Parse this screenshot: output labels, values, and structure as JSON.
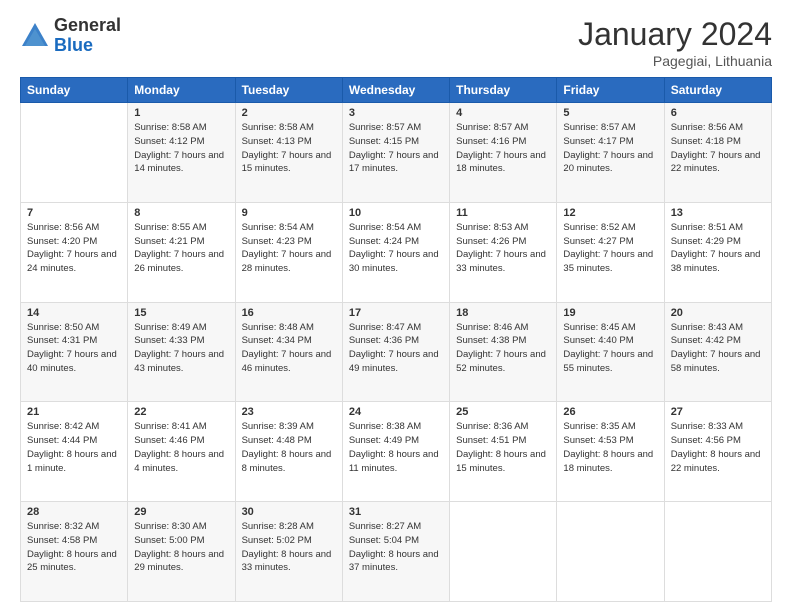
{
  "logo": {
    "general": "General",
    "blue": "Blue"
  },
  "header": {
    "month": "January 2024",
    "location": "Pagegiai, Lithuania"
  },
  "days": [
    "Sunday",
    "Monday",
    "Tuesday",
    "Wednesday",
    "Thursday",
    "Friday",
    "Saturday"
  ],
  "weeks": [
    [
      {
        "day": "",
        "sunrise": "",
        "sunset": "",
        "daylight": ""
      },
      {
        "day": "1",
        "sunrise": "Sunrise: 8:58 AM",
        "sunset": "Sunset: 4:12 PM",
        "daylight": "Daylight: 7 hours and 14 minutes."
      },
      {
        "day": "2",
        "sunrise": "Sunrise: 8:58 AM",
        "sunset": "Sunset: 4:13 PM",
        "daylight": "Daylight: 7 hours and 15 minutes."
      },
      {
        "day": "3",
        "sunrise": "Sunrise: 8:57 AM",
        "sunset": "Sunset: 4:15 PM",
        "daylight": "Daylight: 7 hours and 17 minutes."
      },
      {
        "day": "4",
        "sunrise": "Sunrise: 8:57 AM",
        "sunset": "Sunset: 4:16 PM",
        "daylight": "Daylight: 7 hours and 18 minutes."
      },
      {
        "day": "5",
        "sunrise": "Sunrise: 8:57 AM",
        "sunset": "Sunset: 4:17 PM",
        "daylight": "Daylight: 7 hours and 20 minutes."
      },
      {
        "day": "6",
        "sunrise": "Sunrise: 8:56 AM",
        "sunset": "Sunset: 4:18 PM",
        "daylight": "Daylight: 7 hours and 22 minutes."
      }
    ],
    [
      {
        "day": "7",
        "sunrise": "Sunrise: 8:56 AM",
        "sunset": "Sunset: 4:20 PM",
        "daylight": "Daylight: 7 hours and 24 minutes."
      },
      {
        "day": "8",
        "sunrise": "Sunrise: 8:55 AM",
        "sunset": "Sunset: 4:21 PM",
        "daylight": "Daylight: 7 hours and 26 minutes."
      },
      {
        "day": "9",
        "sunrise": "Sunrise: 8:54 AM",
        "sunset": "Sunset: 4:23 PM",
        "daylight": "Daylight: 7 hours and 28 minutes."
      },
      {
        "day": "10",
        "sunrise": "Sunrise: 8:54 AM",
        "sunset": "Sunset: 4:24 PM",
        "daylight": "Daylight: 7 hours and 30 minutes."
      },
      {
        "day": "11",
        "sunrise": "Sunrise: 8:53 AM",
        "sunset": "Sunset: 4:26 PM",
        "daylight": "Daylight: 7 hours and 33 minutes."
      },
      {
        "day": "12",
        "sunrise": "Sunrise: 8:52 AM",
        "sunset": "Sunset: 4:27 PM",
        "daylight": "Daylight: 7 hours and 35 minutes."
      },
      {
        "day": "13",
        "sunrise": "Sunrise: 8:51 AM",
        "sunset": "Sunset: 4:29 PM",
        "daylight": "Daylight: 7 hours and 38 minutes."
      }
    ],
    [
      {
        "day": "14",
        "sunrise": "Sunrise: 8:50 AM",
        "sunset": "Sunset: 4:31 PM",
        "daylight": "Daylight: 7 hours and 40 minutes."
      },
      {
        "day": "15",
        "sunrise": "Sunrise: 8:49 AM",
        "sunset": "Sunset: 4:33 PM",
        "daylight": "Daylight: 7 hours and 43 minutes."
      },
      {
        "day": "16",
        "sunrise": "Sunrise: 8:48 AM",
        "sunset": "Sunset: 4:34 PM",
        "daylight": "Daylight: 7 hours and 46 minutes."
      },
      {
        "day": "17",
        "sunrise": "Sunrise: 8:47 AM",
        "sunset": "Sunset: 4:36 PM",
        "daylight": "Daylight: 7 hours and 49 minutes."
      },
      {
        "day": "18",
        "sunrise": "Sunrise: 8:46 AM",
        "sunset": "Sunset: 4:38 PM",
        "daylight": "Daylight: 7 hours and 52 minutes."
      },
      {
        "day": "19",
        "sunrise": "Sunrise: 8:45 AM",
        "sunset": "Sunset: 4:40 PM",
        "daylight": "Daylight: 7 hours and 55 minutes."
      },
      {
        "day": "20",
        "sunrise": "Sunrise: 8:43 AM",
        "sunset": "Sunset: 4:42 PM",
        "daylight": "Daylight: 7 hours and 58 minutes."
      }
    ],
    [
      {
        "day": "21",
        "sunrise": "Sunrise: 8:42 AM",
        "sunset": "Sunset: 4:44 PM",
        "daylight": "Daylight: 8 hours and 1 minute."
      },
      {
        "day": "22",
        "sunrise": "Sunrise: 8:41 AM",
        "sunset": "Sunset: 4:46 PM",
        "daylight": "Daylight: 8 hours and 4 minutes."
      },
      {
        "day": "23",
        "sunrise": "Sunrise: 8:39 AM",
        "sunset": "Sunset: 4:48 PM",
        "daylight": "Daylight: 8 hours and 8 minutes."
      },
      {
        "day": "24",
        "sunrise": "Sunrise: 8:38 AM",
        "sunset": "Sunset: 4:49 PM",
        "daylight": "Daylight: 8 hours and 11 minutes."
      },
      {
        "day": "25",
        "sunrise": "Sunrise: 8:36 AM",
        "sunset": "Sunset: 4:51 PM",
        "daylight": "Daylight: 8 hours and 15 minutes."
      },
      {
        "day": "26",
        "sunrise": "Sunrise: 8:35 AM",
        "sunset": "Sunset: 4:53 PM",
        "daylight": "Daylight: 8 hours and 18 minutes."
      },
      {
        "day": "27",
        "sunrise": "Sunrise: 8:33 AM",
        "sunset": "Sunset: 4:56 PM",
        "daylight": "Daylight: 8 hours and 22 minutes."
      }
    ],
    [
      {
        "day": "28",
        "sunrise": "Sunrise: 8:32 AM",
        "sunset": "Sunset: 4:58 PM",
        "daylight": "Daylight: 8 hours and 25 minutes."
      },
      {
        "day": "29",
        "sunrise": "Sunrise: 8:30 AM",
        "sunset": "Sunset: 5:00 PM",
        "daylight": "Daylight: 8 hours and 29 minutes."
      },
      {
        "day": "30",
        "sunrise": "Sunrise: 8:28 AM",
        "sunset": "Sunset: 5:02 PM",
        "daylight": "Daylight: 8 hours and 33 minutes."
      },
      {
        "day": "31",
        "sunrise": "Sunrise: 8:27 AM",
        "sunset": "Sunset: 5:04 PM",
        "daylight": "Daylight: 8 hours and 37 minutes."
      },
      {
        "day": "",
        "sunrise": "",
        "sunset": "",
        "daylight": ""
      },
      {
        "day": "",
        "sunrise": "",
        "sunset": "",
        "daylight": ""
      },
      {
        "day": "",
        "sunrise": "",
        "sunset": "",
        "daylight": ""
      }
    ]
  ]
}
